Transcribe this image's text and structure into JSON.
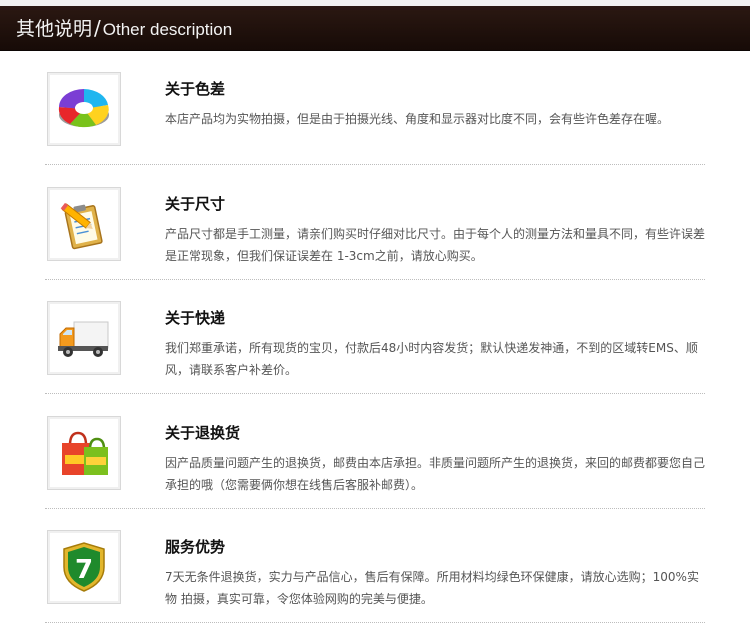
{
  "header": {
    "title_cn": "其他说明",
    "slash": "/",
    "title_en": "Other description"
  },
  "items": [
    {
      "icon": "color-wheel-icon",
      "title": "关于色差",
      "text": "本店产品均为实物拍摄，但是由于拍摄光线、角度和显示器对比度不同，会有些许色差存在喔。"
    },
    {
      "icon": "clipboard-pencil-icon",
      "title": "关于尺寸",
      "text": "产品尺寸都是手工测量，请亲们购买时仔细对比尺寸。由于每个人的测量方法和量具不同，有些许误差是正常现象，但我们保证误差在 1-3cm之前，请放心购买。"
    },
    {
      "icon": "delivery-truck-icon",
      "title": "关于快递",
      "text": "我们郑重承诺，所有现货的宝贝，付款后48小时内容发货；默认快递发神通，不到的区域转EMS、顺风，请联系客户补差价。"
    },
    {
      "icon": "shopping-bags-icon",
      "title": "关于退换货",
      "text": "因产品质量问题产生的退换货，邮费由本店承担。非质量问题所产生的退换货，来回的邮费都要您自己承担的哦（您需要俩你想在线售后客服补邮费）。"
    },
    {
      "icon": "seven-shield-icon",
      "badge": "7",
      "title": "服务优势",
      "text": "7天无条件退换货，实力与产品信心，售后有保障。所用材料均绿色环保健康，请放心选购；100%实物 拍摄，真实可靠，令您体验网购的完美与便捷。"
    }
  ]
}
